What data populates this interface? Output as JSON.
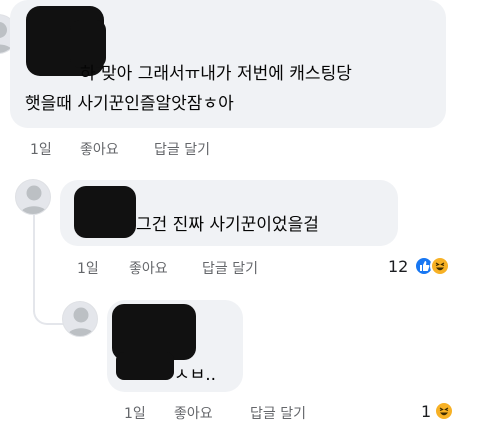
{
  "comments": [
    {
      "text_line1": "하 맞아 그래서ㅠ내가 저번에 캐스팅당",
      "text_line2": "햇을때 사기꾼인즐알앗잠ㅎ아",
      "time": "1일",
      "like": "좋아요",
      "reply": "답글 달기"
    },
    {
      "text_line1": "그건 진짜 사기꾼이었을걸",
      "time": "1일",
      "like": "좋아요",
      "reply": "답글 달기",
      "reaction_count": "12",
      "reactions": [
        "like-icon",
        "haha-icon"
      ]
    },
    {
      "text_line1": "ㅅㅂ..",
      "time": "1일",
      "like": "좋아요",
      "reply": "답글 달기",
      "reaction_count": "1",
      "reactions": [
        "haha-icon"
      ]
    }
  ],
  "colors": {
    "bubble": "#f0f2f5",
    "meta_text": "#65676b",
    "like_blue": "#1877f2",
    "haha_yellow": "#f7b125"
  }
}
